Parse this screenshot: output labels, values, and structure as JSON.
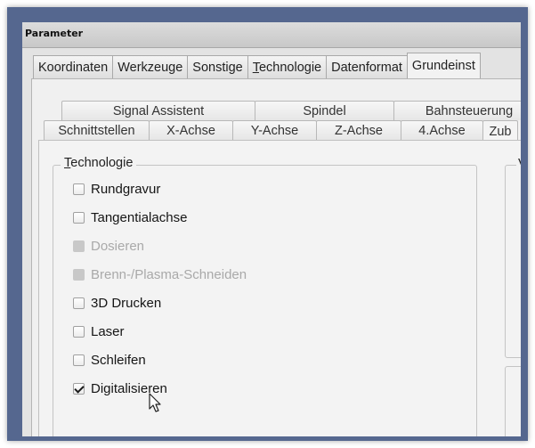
{
  "window": {
    "title": "Parameter"
  },
  "main_tabs": [
    {
      "label": "Koordinaten",
      "active": false
    },
    {
      "label": "Werkzeuge",
      "active": false
    },
    {
      "label": "Sonstige",
      "active": false
    },
    {
      "label": "Technologie",
      "mnemonic": "T",
      "active": false
    },
    {
      "label": "Datenformat",
      "active": false
    },
    {
      "label": "Grundeinst",
      "active": true
    }
  ],
  "sub_tabs_row1": [
    {
      "label": "Signal Assistent"
    },
    {
      "label": "Spindel"
    },
    {
      "label": "Bahnsteuerung"
    }
  ],
  "sub_tabs_row2": [
    {
      "label": "Schnittstellen",
      "active": false
    },
    {
      "label": "X-Achse",
      "active": false
    },
    {
      "label": "Y-Achse",
      "active": false
    },
    {
      "label": "Z-Achse",
      "active": false
    },
    {
      "label": "4.Achse",
      "active": false
    },
    {
      "label": "Zub",
      "active": true
    }
  ],
  "technologie_group": {
    "title": "Technologie",
    "mnemonic": "T",
    "items": [
      {
        "label": "Rundgravur",
        "checked": false,
        "enabled": true
      },
      {
        "label": "Tangentialachse",
        "checked": false,
        "enabled": true
      },
      {
        "label": "Dosieren",
        "checked": false,
        "enabled": false
      },
      {
        "label": "Brenn-/Plasma-Schneiden",
        "checked": false,
        "enabled": false
      },
      {
        "label": "3D Drucken",
        "checked": false,
        "enabled": true
      },
      {
        "label": "Laser",
        "checked": false,
        "enabled": true
      },
      {
        "label": "Schleifen",
        "checked": false,
        "enabled": true
      },
      {
        "label": "Digitalisieren",
        "checked": true,
        "enabled": true
      }
    ]
  },
  "right_group": {
    "title_partial": "V"
  },
  "icons": {
    "cursor": "mouse-pointer-icon"
  },
  "colors": {
    "frame": "#55678f",
    "dialog_bg": "#e3e3e3",
    "disabled_text": "#a9a9a9"
  }
}
